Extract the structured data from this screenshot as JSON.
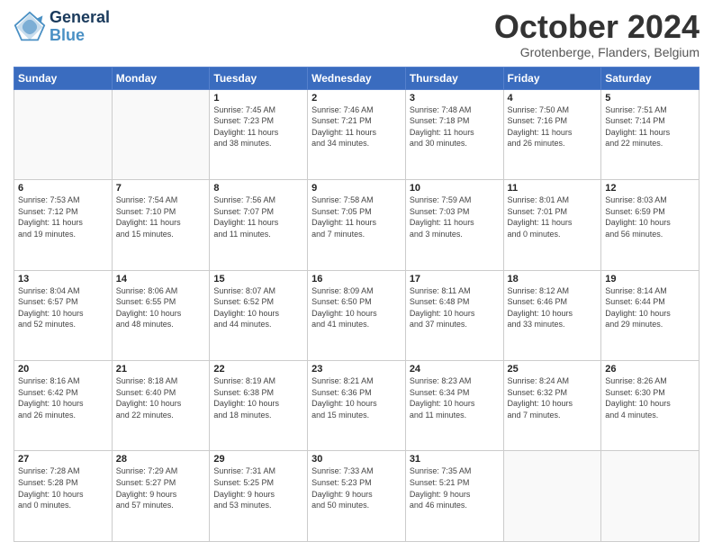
{
  "header": {
    "logo_line1": "General",
    "logo_line2": "Blue",
    "month_title": "October 2024",
    "subtitle": "Grotenberge, Flanders, Belgium"
  },
  "days_of_week": [
    "Sunday",
    "Monday",
    "Tuesday",
    "Wednesday",
    "Thursday",
    "Friday",
    "Saturday"
  ],
  "weeks": [
    [
      {
        "day": "",
        "info": ""
      },
      {
        "day": "",
        "info": ""
      },
      {
        "day": "1",
        "info": "Sunrise: 7:45 AM\nSunset: 7:23 PM\nDaylight: 11 hours\nand 38 minutes."
      },
      {
        "day": "2",
        "info": "Sunrise: 7:46 AM\nSunset: 7:21 PM\nDaylight: 11 hours\nand 34 minutes."
      },
      {
        "day": "3",
        "info": "Sunrise: 7:48 AM\nSunset: 7:18 PM\nDaylight: 11 hours\nand 30 minutes."
      },
      {
        "day": "4",
        "info": "Sunrise: 7:50 AM\nSunset: 7:16 PM\nDaylight: 11 hours\nand 26 minutes."
      },
      {
        "day": "5",
        "info": "Sunrise: 7:51 AM\nSunset: 7:14 PM\nDaylight: 11 hours\nand 22 minutes."
      }
    ],
    [
      {
        "day": "6",
        "info": "Sunrise: 7:53 AM\nSunset: 7:12 PM\nDaylight: 11 hours\nand 19 minutes."
      },
      {
        "day": "7",
        "info": "Sunrise: 7:54 AM\nSunset: 7:10 PM\nDaylight: 11 hours\nand 15 minutes."
      },
      {
        "day": "8",
        "info": "Sunrise: 7:56 AM\nSunset: 7:07 PM\nDaylight: 11 hours\nand 11 minutes."
      },
      {
        "day": "9",
        "info": "Sunrise: 7:58 AM\nSunset: 7:05 PM\nDaylight: 11 hours\nand 7 minutes."
      },
      {
        "day": "10",
        "info": "Sunrise: 7:59 AM\nSunset: 7:03 PM\nDaylight: 11 hours\nand 3 minutes."
      },
      {
        "day": "11",
        "info": "Sunrise: 8:01 AM\nSunset: 7:01 PM\nDaylight: 11 hours\nand 0 minutes."
      },
      {
        "day": "12",
        "info": "Sunrise: 8:03 AM\nSunset: 6:59 PM\nDaylight: 10 hours\nand 56 minutes."
      }
    ],
    [
      {
        "day": "13",
        "info": "Sunrise: 8:04 AM\nSunset: 6:57 PM\nDaylight: 10 hours\nand 52 minutes."
      },
      {
        "day": "14",
        "info": "Sunrise: 8:06 AM\nSunset: 6:55 PM\nDaylight: 10 hours\nand 48 minutes."
      },
      {
        "day": "15",
        "info": "Sunrise: 8:07 AM\nSunset: 6:52 PM\nDaylight: 10 hours\nand 44 minutes."
      },
      {
        "day": "16",
        "info": "Sunrise: 8:09 AM\nSunset: 6:50 PM\nDaylight: 10 hours\nand 41 minutes."
      },
      {
        "day": "17",
        "info": "Sunrise: 8:11 AM\nSunset: 6:48 PM\nDaylight: 10 hours\nand 37 minutes."
      },
      {
        "day": "18",
        "info": "Sunrise: 8:12 AM\nSunset: 6:46 PM\nDaylight: 10 hours\nand 33 minutes."
      },
      {
        "day": "19",
        "info": "Sunrise: 8:14 AM\nSunset: 6:44 PM\nDaylight: 10 hours\nand 29 minutes."
      }
    ],
    [
      {
        "day": "20",
        "info": "Sunrise: 8:16 AM\nSunset: 6:42 PM\nDaylight: 10 hours\nand 26 minutes."
      },
      {
        "day": "21",
        "info": "Sunrise: 8:18 AM\nSunset: 6:40 PM\nDaylight: 10 hours\nand 22 minutes."
      },
      {
        "day": "22",
        "info": "Sunrise: 8:19 AM\nSunset: 6:38 PM\nDaylight: 10 hours\nand 18 minutes."
      },
      {
        "day": "23",
        "info": "Sunrise: 8:21 AM\nSunset: 6:36 PM\nDaylight: 10 hours\nand 15 minutes."
      },
      {
        "day": "24",
        "info": "Sunrise: 8:23 AM\nSunset: 6:34 PM\nDaylight: 10 hours\nand 11 minutes."
      },
      {
        "day": "25",
        "info": "Sunrise: 8:24 AM\nSunset: 6:32 PM\nDaylight: 10 hours\nand 7 minutes."
      },
      {
        "day": "26",
        "info": "Sunrise: 8:26 AM\nSunset: 6:30 PM\nDaylight: 10 hours\nand 4 minutes."
      }
    ],
    [
      {
        "day": "27",
        "info": "Sunrise: 7:28 AM\nSunset: 5:28 PM\nDaylight: 10 hours\nand 0 minutes."
      },
      {
        "day": "28",
        "info": "Sunrise: 7:29 AM\nSunset: 5:27 PM\nDaylight: 9 hours\nand 57 minutes."
      },
      {
        "day": "29",
        "info": "Sunrise: 7:31 AM\nSunset: 5:25 PM\nDaylight: 9 hours\nand 53 minutes."
      },
      {
        "day": "30",
        "info": "Sunrise: 7:33 AM\nSunset: 5:23 PM\nDaylight: 9 hours\nand 50 minutes."
      },
      {
        "day": "31",
        "info": "Sunrise: 7:35 AM\nSunset: 5:21 PM\nDaylight: 9 hours\nand 46 minutes."
      },
      {
        "day": "",
        "info": ""
      },
      {
        "day": "",
        "info": ""
      }
    ]
  ]
}
